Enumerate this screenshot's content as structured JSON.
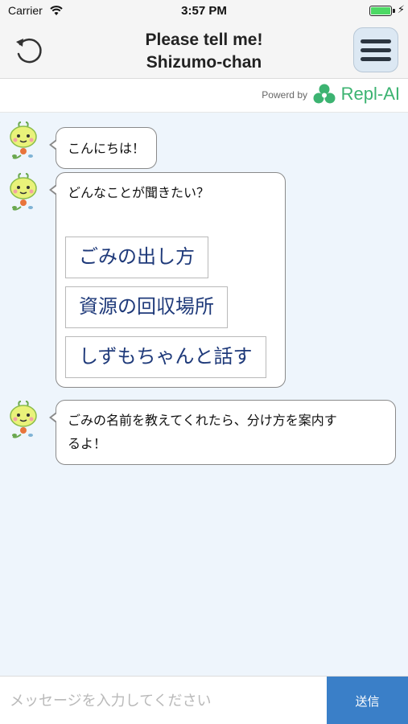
{
  "status_bar": {
    "carrier": "Carrier",
    "time": "3:57 PM",
    "battery_level": 1.0,
    "battery_color": "#4cd964"
  },
  "nav": {
    "title_line1": "Please tell me!",
    "title_line2": "Shizumo-chan",
    "back_icon": "refresh-back-icon",
    "menu_icon": "hamburger-menu-icon"
  },
  "powered": {
    "by_text": "Powerd by",
    "brand": "Repl-AI",
    "brand_color": "#3cb371"
  },
  "chat": {
    "background": "#eef5fc",
    "messages": [
      {
        "sender_avatar": "shizumo-chan-avatar",
        "text": "こんにちは！"
      },
      {
        "sender_avatar": "shizumo-chan-avatar",
        "text": "どんなことが聞きたい？",
        "options": [
          "ごみの出し方",
          "資源の回収場所",
          "しずもちゃんと話す"
        ]
      },
      {
        "sender_avatar": "shizumo-chan-avatar",
        "text_line1": "ごみの名前を教えてくれたら、分け方を案内す",
        "text_line2": "るよ！"
      }
    ]
  },
  "input_bar": {
    "placeholder": "メッセージを入力してください",
    "value": "",
    "send_label": "送信",
    "send_color": "#3a7fc8"
  }
}
